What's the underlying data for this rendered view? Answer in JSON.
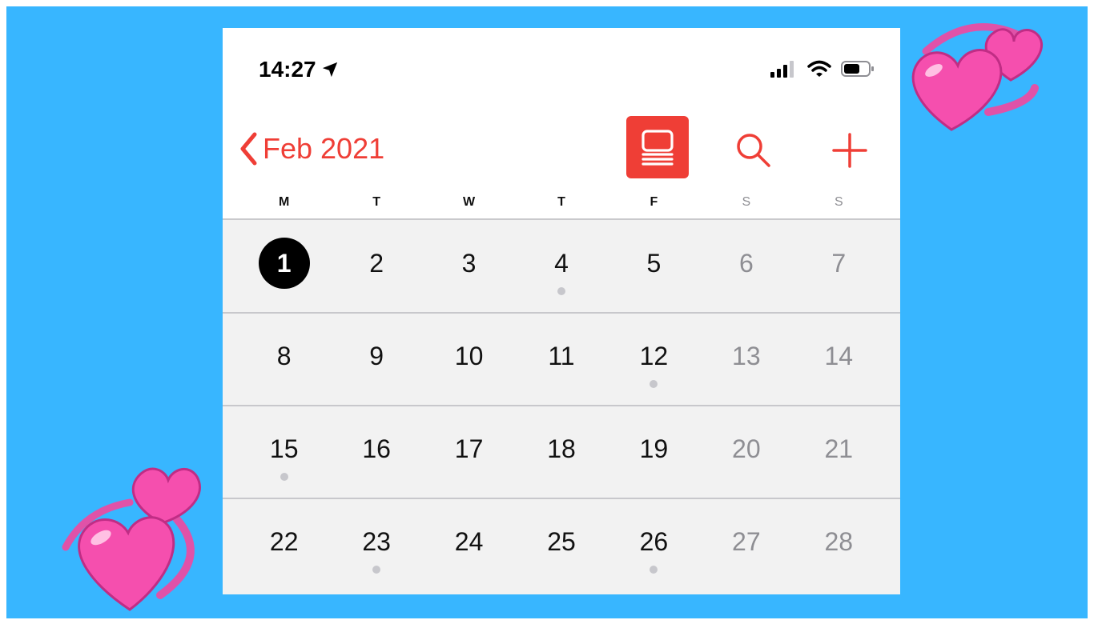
{
  "status_bar": {
    "time": "14:27",
    "icons": [
      "location-arrow-icon",
      "cellular-signal-icon",
      "wifi-icon",
      "battery-icon"
    ]
  },
  "nav": {
    "back_icon": "chevron-left-icon",
    "month_label": "Feb 2021",
    "actions": [
      "list-view-icon",
      "search-icon",
      "add-icon"
    ]
  },
  "colors": {
    "accent": "#ef3e36",
    "background": "#38b6ff",
    "heart": "#f54fae"
  },
  "weekdays": [
    "M",
    "T",
    "W",
    "T",
    "F",
    "S",
    "S"
  ],
  "weeks": [
    [
      {
        "day": "1",
        "today": true
      },
      {
        "day": "2"
      },
      {
        "day": "3"
      },
      {
        "day": "4",
        "event": true
      },
      {
        "day": "5"
      },
      {
        "day": "6"
      },
      {
        "day": "7"
      }
    ],
    [
      {
        "day": "8"
      },
      {
        "day": "9"
      },
      {
        "day": "10"
      },
      {
        "day": "11"
      },
      {
        "day": "12",
        "event": true
      },
      {
        "day": "13"
      },
      {
        "day": "14"
      }
    ],
    [
      {
        "day": "15",
        "event": true
      },
      {
        "day": "16"
      },
      {
        "day": "17"
      },
      {
        "day": "18"
      },
      {
        "day": "19"
      },
      {
        "day": "20"
      },
      {
        "day": "21"
      }
    ],
    [
      {
        "day": "22"
      },
      {
        "day": "23",
        "event": true
      },
      {
        "day": "24"
      },
      {
        "day": "25"
      },
      {
        "day": "26",
        "event": true
      },
      {
        "day": "27"
      },
      {
        "day": "28"
      }
    ]
  ],
  "decorations": [
    "revolving-hearts-icon",
    "revolving-hearts-icon"
  ]
}
